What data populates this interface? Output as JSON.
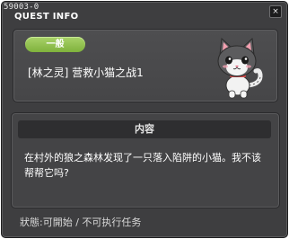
{
  "window": {
    "id_text": "59003-0",
    "title": "QUEST INFO",
    "close_label": "×"
  },
  "quest": {
    "category": "一般",
    "name": "[林之灵] 营救小猫之战1",
    "portrait_icon": "cat-icon"
  },
  "details": {
    "header": "内容",
    "description": "在村外的狼之森林发现了一只落入陷阱的小猫。我不该帮帮它吗?"
  },
  "status": {
    "text": "狀態:可開始 / 不可执行任务"
  },
  "colors": {
    "badge_green": "#8fc14a",
    "window_bg": "#3e3e40",
    "panel_bg": "#4a4a4c",
    "header_bg": "#2e2e30"
  }
}
